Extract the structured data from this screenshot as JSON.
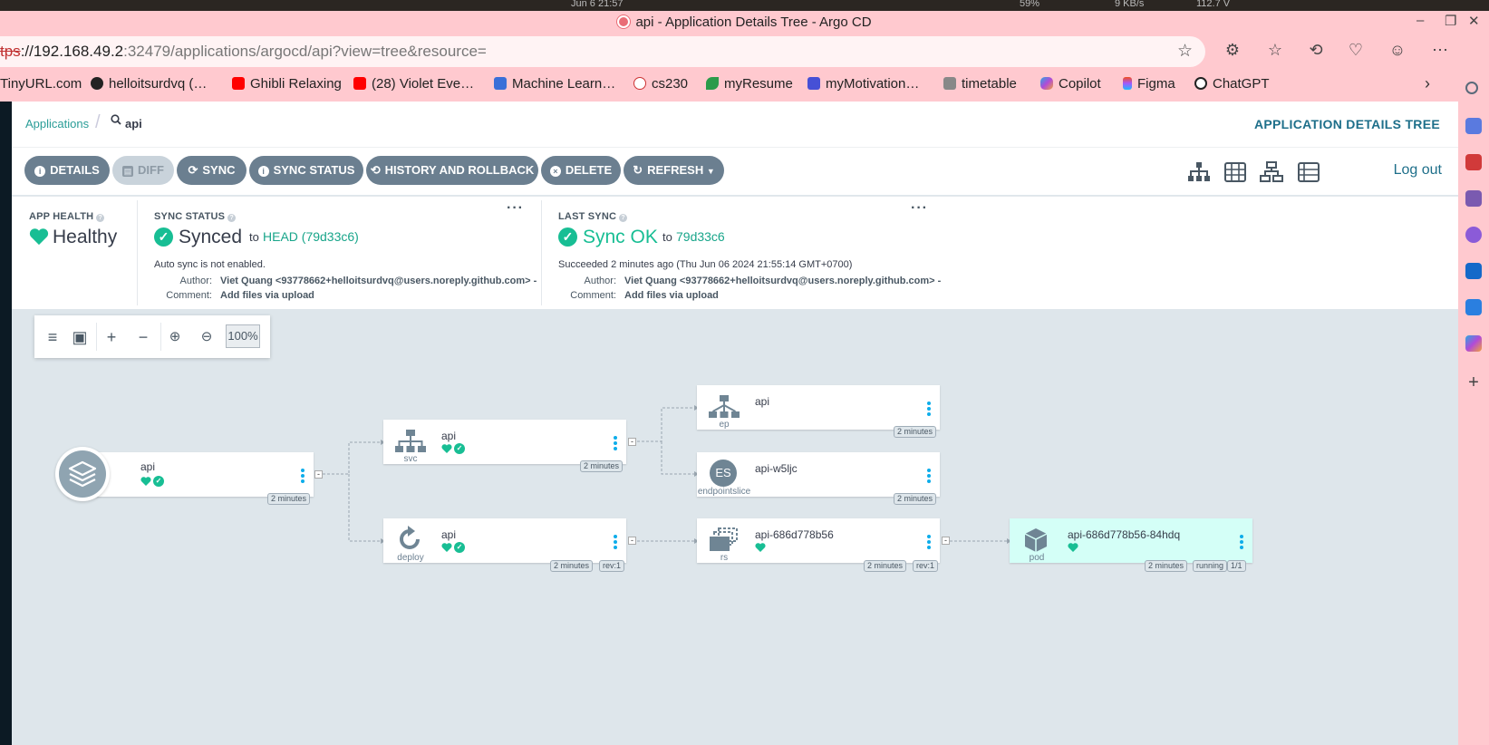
{
  "os": {
    "clock": "Jun 6 21:57",
    "battery": "59%",
    "net": "9 KB/s",
    "power": "112.7 V"
  },
  "browser": {
    "window_title": "api - Application Details Tree - Argo CD",
    "url_scheme": "tps",
    "url_host": "://192.168.49.2",
    "url_rest": ":32479/applications/argocd/api?view=tree&resource=",
    "bookmarks": [
      {
        "label": "TinyURL.com",
        "icon": "tinyurl-icon",
        "color": "#2b6bd6"
      },
      {
        "label": "helloitsurdvq (…",
        "icon": "github-icon",
        "color": "#222222"
      },
      {
        "label": "Ghibli Relaxing",
        "icon": "youtube-icon",
        "color": "#ff0000"
      },
      {
        "label": "(28) Violet Eve…",
        "icon": "youtube-icon",
        "color": "#ff0000"
      },
      {
        "label": "Machine Learn…",
        "icon": "image-icon",
        "color": "#3a6fd8"
      },
      {
        "label": "cs230",
        "icon": "info-icon",
        "color": "#c33"
      },
      {
        "label": "myResume",
        "icon": "leaf-icon",
        "color": "#2b9b4a"
      },
      {
        "label": "myMotivation…",
        "icon": "app-icon",
        "color": "#4650d6"
      },
      {
        "label": "timetable",
        "icon": "image-icon",
        "color": "#888888"
      },
      {
        "label": "Copilot",
        "icon": "copilot-icon",
        "color": "#7b55e0"
      },
      {
        "label": "Figma",
        "icon": "figma-icon",
        "color": "#f24e1e"
      },
      {
        "label": "ChatGPT",
        "icon": "chatgpt-icon",
        "color": "#222222"
      }
    ]
  },
  "breadcrumb": {
    "root": "Applications",
    "current": "api"
  },
  "page_title": "APPLICATION DETAILS TREE",
  "actions": {
    "details": "DETAILS",
    "diff": "DIFF",
    "sync": "SYNC",
    "sync_status": "SYNC STATUS",
    "history": "HISTORY AND ROLLBACK",
    "delete": "DELETE",
    "refresh": "REFRESH",
    "logout": "Log out"
  },
  "status": {
    "app_health": {
      "heading": "APP HEALTH",
      "value": "Healthy"
    },
    "sync_status": {
      "heading": "SYNC STATUS",
      "value": "Synced",
      "to_word": "to",
      "revision": "HEAD (79d33c6)",
      "note": "Auto sync is not enabled.",
      "author_label": "Author:",
      "author": "Viet Quang <93778662+helloitsurdvq@users.noreply.github.com> -",
      "comment_label": "Comment:",
      "comment": "Add files via upload"
    },
    "last_sync": {
      "heading": "LAST SYNC",
      "value": "Sync OK",
      "to_word": "to",
      "revision": "79d33c6",
      "note": "Succeeded 2 minutes ago (Thu Jun 06 2024 21:55:14 GMT+0700)",
      "author_label": "Author:",
      "author": "Viet Quang <93778662+helloitsurdvq@users.noreply.github.com> -",
      "comment_label": "Comment:",
      "comment": "Add files via upload"
    },
    "colors": {
      "healthy": "#18be94",
      "accent": "#1e6f8a",
      "button": "#6b7f90"
    }
  },
  "graph": {
    "zoom": "100%",
    "nodes": [
      {
        "id": "app",
        "name": "api",
        "kind": "",
        "age": "2 minutes"
      },
      {
        "id": "svc",
        "name": "api",
        "kind": "svc",
        "age": "2 minutes"
      },
      {
        "id": "deploy",
        "name": "api",
        "kind": "deploy",
        "age": "2 minutes",
        "rev": "rev:1"
      },
      {
        "id": "ep",
        "name": "api",
        "kind": "ep",
        "age": "2 minutes"
      },
      {
        "id": "endpointslice",
        "name": "api-w5ljc",
        "kind": "endpointslice",
        "badge": "ES",
        "age": "2 minutes"
      },
      {
        "id": "rs",
        "name": "api-686d778b56",
        "kind": "rs",
        "age": "2 minutes",
        "rev": "rev:1"
      },
      {
        "id": "pod",
        "name": "api-686d778b56-84hdq",
        "kind": "pod",
        "age": "2 minutes",
        "status": "running",
        "containers": "1/1"
      }
    ]
  }
}
